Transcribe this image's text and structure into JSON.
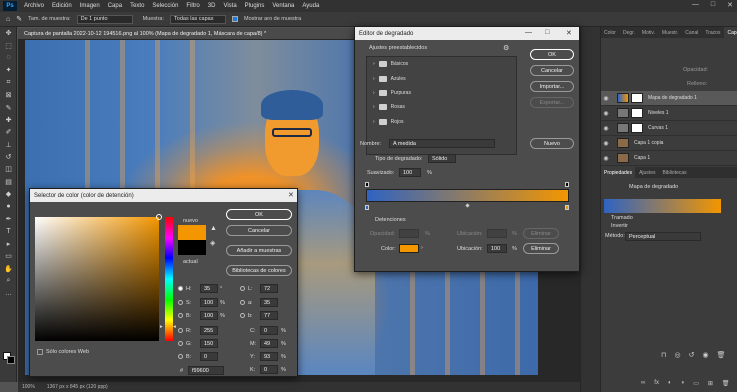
{
  "app": {
    "logo": "Ps"
  },
  "menu": [
    "Archivo",
    "Edición",
    "Imagen",
    "Capa",
    "Texto",
    "Selección",
    "Filtro",
    "3D",
    "Vista",
    "Plugins",
    "Ventana",
    "Ayuda"
  ],
  "options_bar": {
    "sample_size_label": "Tam. de muestra:",
    "sample_size_value": "De 1 punto",
    "sample_label": "Muestra:",
    "sample_value": "Todas las capas",
    "show_ring_label": "Mostrar aro de muestra"
  },
  "document": {
    "tab_title": "Captura de pantalla 2022-10-12 194516.png al 100% (Mapa de degradado 1, Máscara de capa/8) *",
    "zoom": "100%",
    "size": "1367 px x 845 px (120 ppp)"
  },
  "layers_panel": {
    "tabs": [
      "Color",
      "Degr.",
      "Motiv.",
      "Muestr.",
      "Canal",
      "Trazos",
      "Capas"
    ],
    "active_tab": "Capas",
    "opacity_label": "Opacidad:",
    "fill_label": "Relleno:",
    "layers": [
      {
        "name": "Mapa de degradado 1"
      },
      {
        "name": "Niveles 1"
      },
      {
        "name": "Curvas 1"
      },
      {
        "name": "Capa 1 copia"
      },
      {
        "name": "Capa 1"
      }
    ]
  },
  "properties_panel": {
    "tabs": [
      "Propiedades",
      "Ajustes",
      "Bibliotecas"
    ],
    "title": "Mapa de degradado",
    "dither_label": "Tramado",
    "reverse_label": "Invertir",
    "method_label": "Método:",
    "method_value": "Perceptual"
  },
  "gradient_editor": {
    "title": "Editor de degradado",
    "presets_label": "Ajustes preestablecidos",
    "folders": [
      "Básicos",
      "Azules",
      "Purpuras",
      "Rosas",
      "Rojos"
    ],
    "buttons": {
      "ok": "OK",
      "cancel": "Cancelar",
      "import": "Importar...",
      "export": "Exportar...",
      "new": "Nuevo"
    },
    "name_label": "Nombre:",
    "name_value": "A medida",
    "type_label": "Tipo de degradado:",
    "type_value": "Sólido",
    "smoothness_label": "Suavizado:",
    "smoothness_value": "100",
    "percent": "%",
    "stops_label": "Detenciones",
    "opacity_label": "Opacidad:",
    "location_label": "Ubicación:",
    "location_value": "100",
    "delete_label": "Eliminar",
    "color_label": "Color:",
    "gradient_start": "#2f63c2",
    "gradient_end": "#f39600"
  },
  "color_picker": {
    "title": "Selector de color (color de detención)",
    "new_label": "nuevo",
    "current_label": "actual",
    "new_color": "#f39600",
    "current_color": "#000000",
    "buttons": {
      "ok": "OK",
      "cancel": "Cancelar",
      "add_swatches": "Añadir a muestras",
      "libraries": "Bibliotecas de colores"
    },
    "web_only_label": "Sólo colores Web",
    "fields": {
      "H": "35",
      "S": "100",
      "B": "100",
      "R": "255",
      "G": "150",
      "Bl": "0",
      "L": "72",
      "a": "35",
      "b": "77",
      "C": "0",
      "M": "49",
      "Y": "93",
      "K": "0"
    },
    "deg": "°",
    "pct": "%",
    "hex_label": "#",
    "hex_value": "f99600"
  }
}
